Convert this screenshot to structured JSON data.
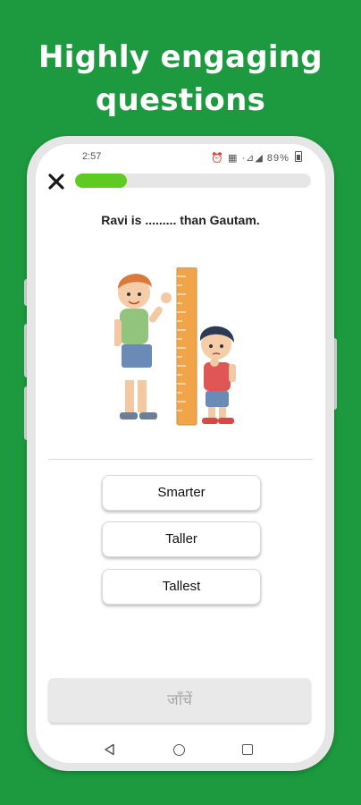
{
  "headline": {
    "line1": "Highly engaging",
    "line2": "questions"
  },
  "status_bar": {
    "time": "2:57",
    "icons_text": "⏰ ▦ ·⊿◢",
    "battery": "89%"
  },
  "quiz": {
    "progress_fraction": 0.22,
    "question": "Ravi is ......... than Gautam.",
    "options": [
      "Smarter",
      "Taller",
      "Tallest"
    ],
    "check_label": "जाँचें"
  },
  "colors": {
    "background": "#1d9a3f",
    "progress_fill": "#5fcb22",
    "progress_track": "#e6e6e6"
  },
  "icons": {
    "close": "close-icon",
    "nav_back": "back-triangle-icon",
    "nav_home": "home-circle-icon",
    "nav_recent": "recent-square-icon"
  }
}
